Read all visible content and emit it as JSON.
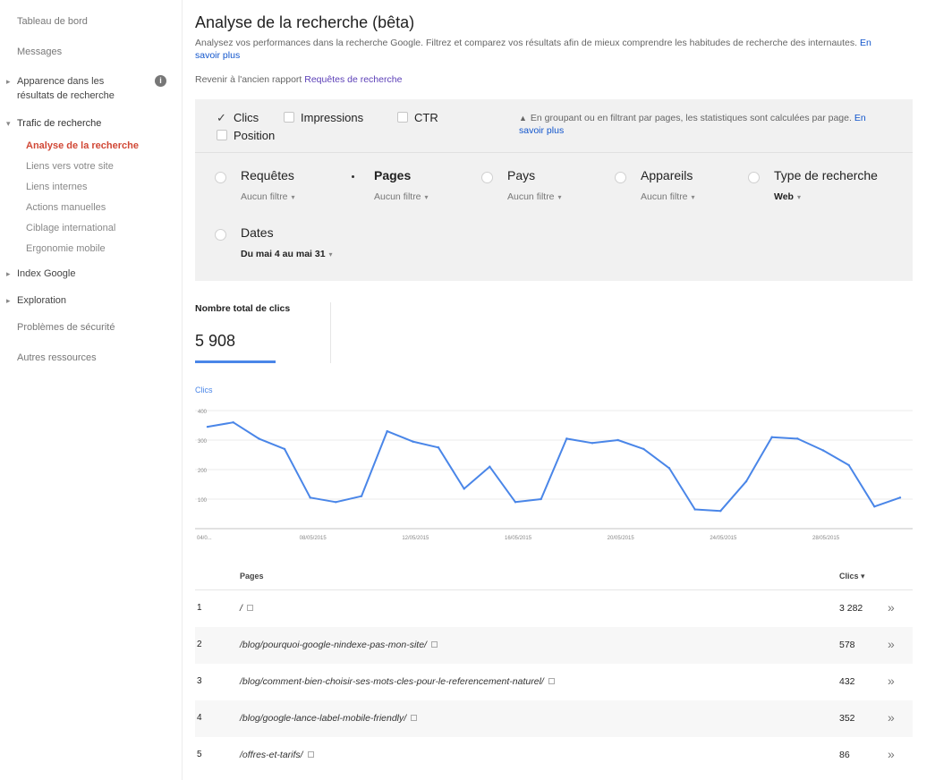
{
  "sidebar": {
    "dashboard": "Tableau de bord",
    "messages": "Messages",
    "appearance": "Apparence dans les résultats de recherche",
    "info_icon": "i",
    "search_traffic": "Trafic de recherche",
    "sub_items": [
      "Analyse de la recherche",
      "Liens vers votre site",
      "Liens internes",
      "Actions manuelles",
      "Ciblage international",
      "Ergonomie mobile"
    ],
    "google_index": "Index Google",
    "crawl": "Exploration",
    "security": "Problèmes de sécurité",
    "other": "Autres ressources"
  },
  "header": {
    "title": "Analyse de la recherche (bêta)",
    "description": "Analysez vos performances dans la recherche Google. Filtrez et comparez vos résultats afin de mieux comprendre les habitudes de recherche des internautes.",
    "learn_more": "En savoir plus",
    "revert_text": "Revenir à l'ancien rapport",
    "revert_link": "Requêtes de recherche"
  },
  "metrics": {
    "clicks": "Clics",
    "impressions": "Impressions",
    "ctr": "CTR",
    "position": "Position",
    "note": "En groupant ou en filtrant par pages, les statistiques sont calculées par page.",
    "note_link": "En savoir plus"
  },
  "dimensions": {
    "queries": {
      "label": "Requêtes",
      "filter": "Aucun filtre"
    },
    "pages": {
      "label": "Pages",
      "filter": "Aucun filtre"
    },
    "countries": {
      "label": "Pays",
      "filter": "Aucun filtre"
    },
    "devices": {
      "label": "Appareils",
      "filter": "Aucun filtre"
    },
    "search_type": {
      "label": "Type de recherche",
      "filter": "Web"
    },
    "dates": {
      "label": "Dates",
      "filter": "Du mai 4 au mai 31"
    }
  },
  "totals": {
    "label": "Nombre total de clics",
    "value": "5 908"
  },
  "chart_data": {
    "type": "line",
    "series": [
      {
        "name": "Clics",
        "values": [
          345,
          360,
          305,
          270,
          105,
          90,
          110,
          330,
          295,
          275,
          135,
          210,
          90,
          100,
          305,
          290,
          300,
          270,
          205,
          65,
          60,
          160,
          310,
          305,
          265,
          215,
          75,
          105
        ]
      }
    ],
    "x_tick_labels": [
      "04/0...",
      "08/05/2015",
      "12/05/2015",
      "16/05/2015",
      "20/05/2015",
      "24/05/2015",
      "28/05/2015"
    ],
    "y_tick_labels": [
      "400",
      "300",
      "200",
      "100"
    ],
    "ylim": [
      0,
      400
    ],
    "color": "#4a86e8",
    "grid": true
  },
  "table": {
    "col_pages": "Pages",
    "col_clicks": "Clics ▾",
    "go_icon": "»",
    "rows": [
      {
        "rank": "1",
        "page": "/",
        "clicks": "3 282"
      },
      {
        "rank": "2",
        "page": "/blog/pourquoi-google-nindexe-pas-mon-site/",
        "clicks": "578"
      },
      {
        "rank": "3",
        "page": "/blog/comment-bien-choisir-ses-mots-cles-pour-le-referencement-naturel/",
        "clicks": "432"
      },
      {
        "rank": "4",
        "page": "/blog/google-lance-label-mobile-friendly/",
        "clicks": "352"
      },
      {
        "rank": "5",
        "page": "/offres-et-tarifs/",
        "clicks": "86"
      }
    ]
  }
}
